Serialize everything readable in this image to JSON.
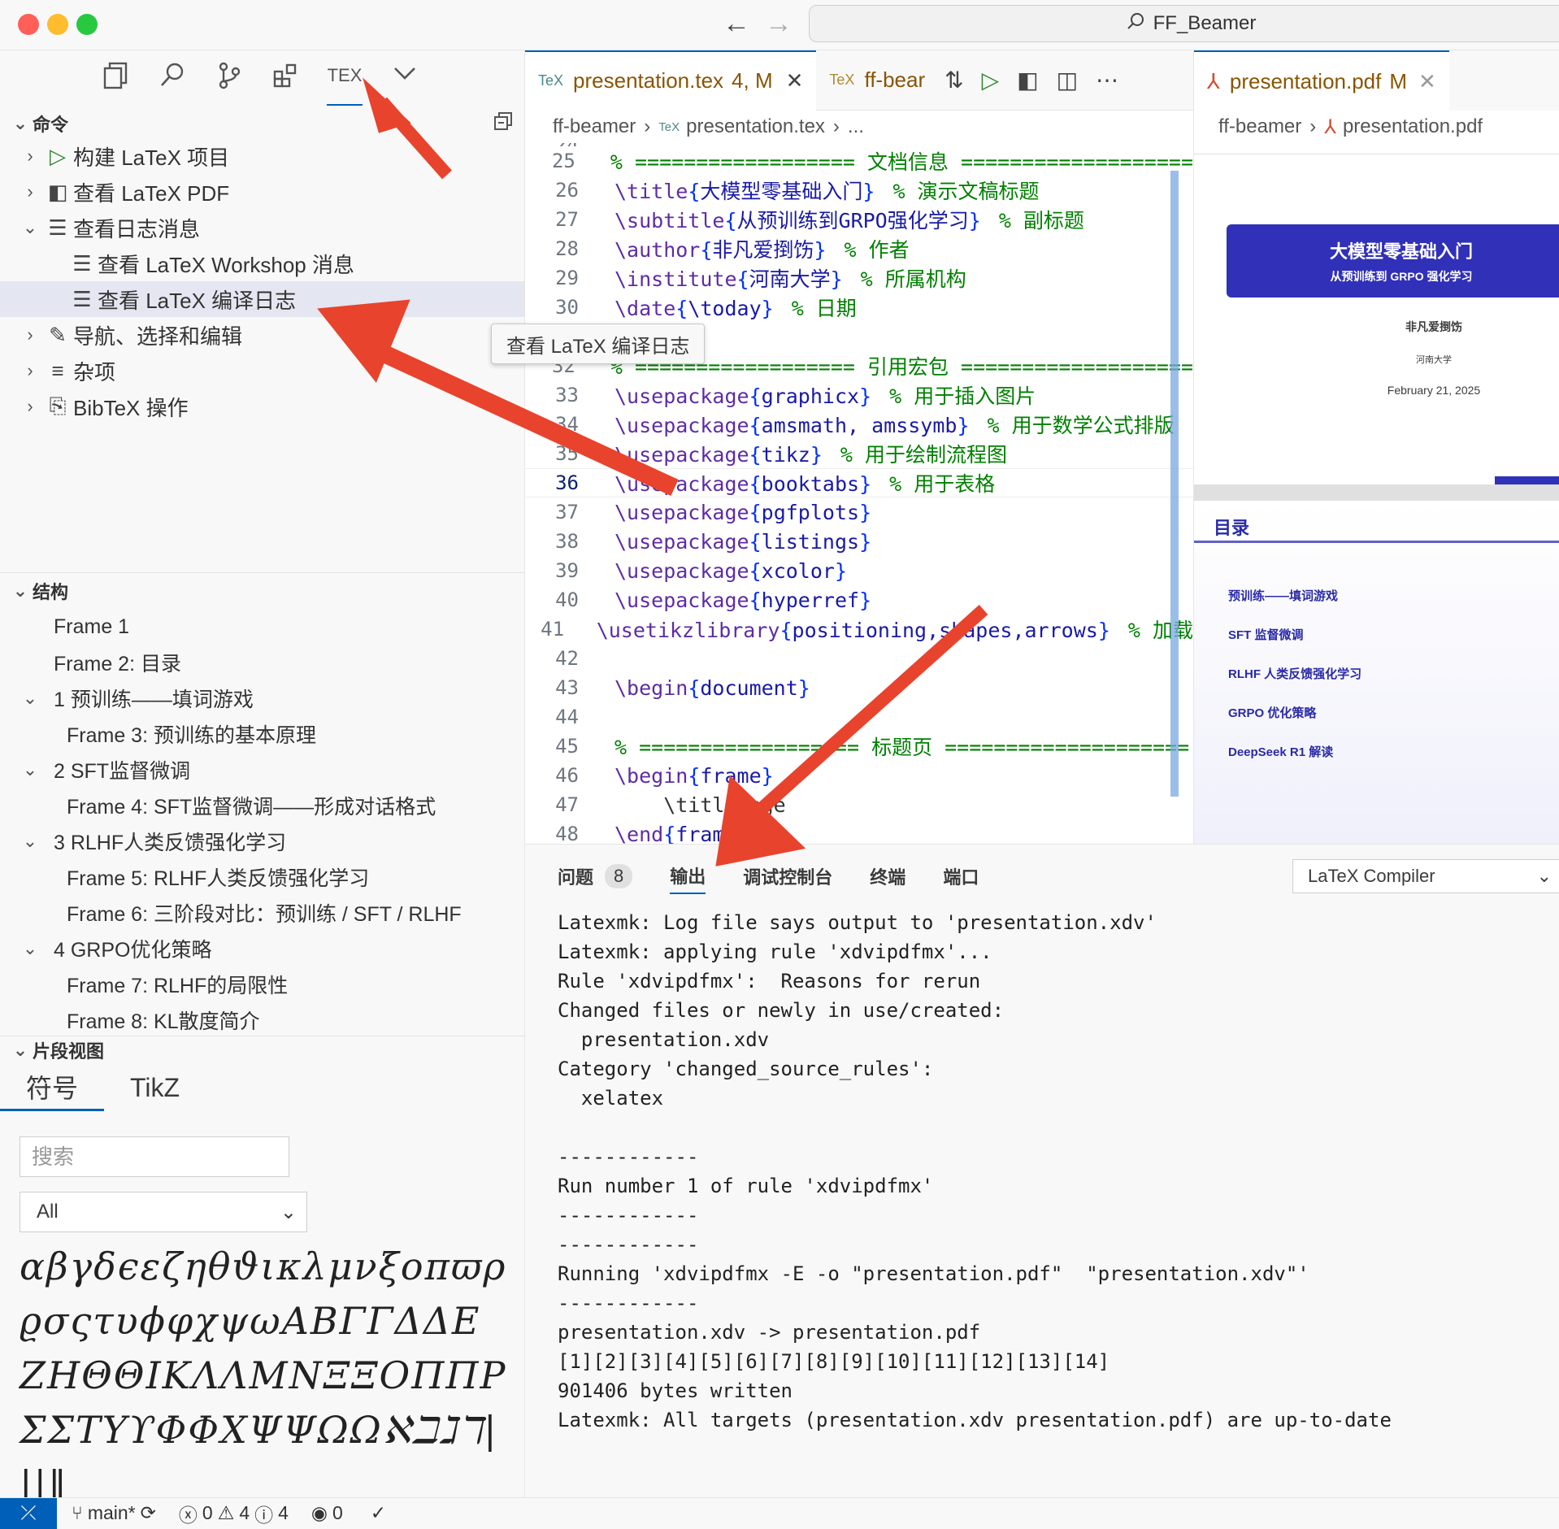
{
  "window": {
    "title": "FF_Beamer"
  },
  "nav": {
    "back": "←",
    "forward": "→"
  },
  "activity_bar": {
    "tex_label": "TEX"
  },
  "commands": {
    "header": "命令",
    "items": [
      {
        "label": "构建 LaTeX 项目"
      },
      {
        "label": "查看 LaTeX PDF"
      },
      {
        "label": "查看日志消息"
      },
      {
        "label": "查看 LaTeX Workshop 消息"
      },
      {
        "label": "查看 LaTeX 编译日志"
      },
      {
        "label": "导航、选择和编辑"
      },
      {
        "label": "杂项"
      },
      {
        "label": "BibTeX 操作"
      }
    ],
    "tooltip": "查看 LaTeX 编译日志"
  },
  "structure": {
    "header": "结构",
    "items": [
      "Frame 1",
      "Frame 2: 目录",
      "1 预训练——填词游戏",
      "Frame 3: 预训练的基本原理",
      "2 SFT监督微调",
      "Frame 4: SFT监督微调——形成对话格式",
      "3 RLHF人类反馈强化学习",
      "Frame 5: RLHF人类反馈强化学习",
      "Frame 6: 三阶段对比：预训练 / SFT / RLHF",
      "4 GRPO优化策略",
      "Frame 7: RLHF的局限性",
      "Frame 8: KL散度简介"
    ]
  },
  "snippets": {
    "header": "片段视图",
    "tabs": [
      "符号",
      "TikZ"
    ],
    "search_placeholder": "搜索",
    "filter": "All",
    "symbols": "αβγδϵεζηθϑικλμνξοπϖρϱσςτυϕφχψωΑΒΓΓΔΔΕΖΗΘΘΙΚΛΛΜΝΞΞΟΠΠΡΣΣΤΥϒΦΦΧΨΨΩΩℵℶℷℸ|||‖"
  },
  "editor": {
    "tabs": [
      {
        "label": "presentation.tex",
        "status": "4, M"
      },
      {
        "label": "ff-bear"
      }
    ],
    "breadcrumb": [
      "ff-beamer",
      "presentation.tex",
      "..."
    ],
    "top_line_number": "24",
    "lines": [
      {
        "n": "25",
        "code": "% ================== 文档信息 ==================="
      },
      {
        "n": "26",
        "cmd": "\\title",
        "arg": "大模型零基础入门",
        "comment": "% 演示文稿标题"
      },
      {
        "n": "27",
        "cmd": "\\subtitle",
        "arg": "从预训练到GRPO强化学习",
        "comment": "% 副标题"
      },
      {
        "n": "28",
        "cmd": "\\author",
        "arg": "非凡爱捯饬",
        "comment": "% 作者"
      },
      {
        "n": "29",
        "cmd": "\\institute",
        "arg": "河南大学",
        "comment": "% 所属机构"
      },
      {
        "n": "30",
        "cmd": "\\date",
        "arg": "\\today",
        "comment": "% 日期"
      },
      {
        "n": "31",
        "code": ""
      },
      {
        "n": "32",
        "code": "% ================== 引用宏包 ==================="
      },
      {
        "n": "33",
        "cmd": "\\usepackage",
        "arg": "graphicx",
        "comment": "% 用于插入图片"
      },
      {
        "n": "34",
        "cmd": "\\usepackage",
        "arg": "amsmath, amssymb",
        "comment": "% 用于数学公式排版"
      },
      {
        "n": "35",
        "cmd": "\\usepackage",
        "arg": "tikz",
        "comment": "% 用于绘制流程图"
      },
      {
        "n": "36",
        "cmd": "\\usepackage",
        "arg": "booktabs",
        "comment": "% 用于表格"
      },
      {
        "n": "37",
        "cmd": "\\usepackage",
        "arg": "pgfplots",
        "comment": ""
      },
      {
        "n": "38",
        "cmd": "\\usepackage",
        "arg": "listings",
        "comment": ""
      },
      {
        "n": "39",
        "cmd": "\\usepackage",
        "arg": "xcolor",
        "comment": ""
      },
      {
        "n": "40",
        "cmd": "\\usepackage",
        "arg": "hyperref",
        "comment": ""
      },
      {
        "n": "41",
        "cmd": "\\usetikzlibrary",
        "arg": "positioning,shapes,arrows",
        "comment": "% 加载"
      },
      {
        "n": "42",
        "code": ""
      },
      {
        "n": "43",
        "cmd": "\\begin",
        "arg": "document",
        "comment": ""
      },
      {
        "n": "44",
        "code": ""
      },
      {
        "n": "45",
        "code": "% ================== 标题页 ===================="
      },
      {
        "n": "46",
        "cmd": "\\begin",
        "arg": "frame",
        "comment": ""
      },
      {
        "n": "47",
        "code": "    \\titlepage"
      },
      {
        "n": "48",
        "cmd": "\\end",
        "arg": "frame",
        "comment": ""
      }
    ]
  },
  "pdf": {
    "tab_label": "presentation.pdf",
    "tab_status": "M",
    "breadcrumb": [
      "ff-beamer",
      "presentation.pdf"
    ],
    "slide1": {
      "title": "大模型零基础入门",
      "subtitle": "从预训练到 GRPO 强化学习",
      "author": "非凡爱捯饬",
      "institute": "河南大学",
      "date": "February 21, 2025"
    },
    "slide2": {
      "title": "目录",
      "toc": [
        "预训练——填词游戏",
        "SFT 监督微调",
        "RLHF 人类反馈强化学习",
        "GRPO 优化策略",
        "DeepSeek R1 解读"
      ]
    }
  },
  "panel": {
    "tabs": [
      "问题",
      "输出",
      "调试控制台",
      "终端",
      "端口"
    ],
    "problems_count": "8",
    "channel": "LaTeX Compiler",
    "output": [
      "Latexmk: Log file says output to 'presentation.xdv'",
      "Latexmk: applying rule 'xdvipdfmx'...",
      "Rule 'xdvipdfmx':  Reasons for rerun",
      "Changed files or newly in use/created:",
      "  presentation.xdv",
      "Category 'changed_source_rules':",
      "  xelatex",
      "",
      "------------",
      "Run number 1 of rule 'xdvipdfmx'",
      "------------",
      "------------",
      "Running 'xdvipdfmx -E -o \"presentation.pdf\"  \"presentation.xdv\"'",
      "------------",
      "presentation.xdv -> presentation.pdf",
      "[1][2][3][4][5][6][7][8][9][10][11][12][13][14]",
      "901406 bytes written",
      "Latexmk: All targets (presentation.xdv presentation.pdf) are up-to-date"
    ]
  },
  "statusbar": {
    "branch": "main*",
    "errors": "0",
    "warnings": "4",
    "infos": "4",
    "ports": "0"
  },
  "colors": {
    "accent": "#005fb8",
    "arrow": "#e8432d",
    "beamer_blue": "#3030b8"
  }
}
